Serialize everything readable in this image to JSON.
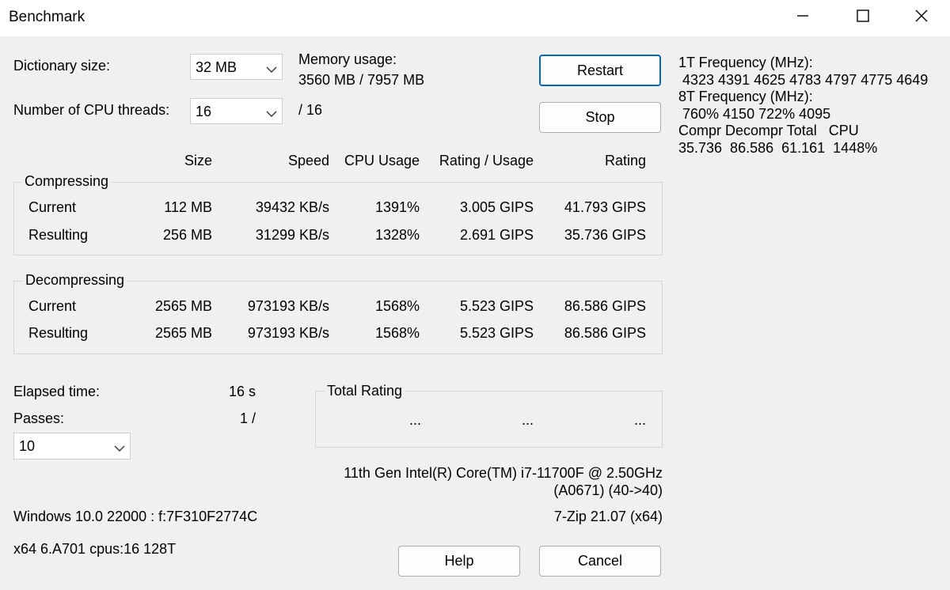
{
  "window": {
    "title": "Benchmark",
    "controls": {
      "minimize": "minimize",
      "maximize": "maximize",
      "close": "close"
    }
  },
  "settings": {
    "dictionary_label": "Dictionary size:",
    "dictionary_value": "32 MB",
    "threads_label": "Number of CPU threads:",
    "threads_value": "16",
    "threads_max": "/ 16",
    "memory_label": "Memory usage:",
    "memory_value": "3560 MB / 7957 MB"
  },
  "buttons": {
    "restart": "Restart",
    "stop": "Stop",
    "help": "Help",
    "cancel": "Cancel"
  },
  "table": {
    "headers": {
      "size": "Size",
      "speed": "Speed",
      "cpu": "CPU Usage",
      "rating_usage": "Rating / Usage",
      "rating": "Rating"
    },
    "compressing": {
      "label": "Compressing",
      "rows": [
        {
          "name": "Current",
          "size": "112 MB",
          "speed": "39432 KB/s",
          "cpu": "1391%",
          "rating_usage": "3.005 GIPS",
          "rating": "41.793 GIPS"
        },
        {
          "name": "Resulting",
          "size": "256 MB",
          "speed": "31299 KB/s",
          "cpu": "1328%",
          "rating_usage": "2.691 GIPS",
          "rating": "35.736 GIPS"
        }
      ]
    },
    "decompressing": {
      "label": "Decompressing",
      "rows": [
        {
          "name": "Current",
          "size": "2565 MB",
          "speed": "973193 KB/s",
          "cpu": "1568%",
          "rating_usage": "5.523 GIPS",
          "rating": "86.586 GIPS"
        },
        {
          "name": "Resulting",
          "size": "2565 MB",
          "speed": "973193 KB/s",
          "cpu": "1568%",
          "rating_usage": "5.523 GIPS",
          "rating": "86.586 GIPS"
        }
      ]
    }
  },
  "status": {
    "elapsed_label": "Elapsed time:",
    "elapsed_value": "16 s",
    "passes_label": "Passes:",
    "passes_value": "1 /",
    "passes_select": "10"
  },
  "total_rating": {
    "label": "Total Rating",
    "values": [
      "...",
      "...",
      "..."
    ]
  },
  "cpu_info": {
    "line1": "11th Gen Intel(R) Core(TM) i7-11700F @ 2.50GHz",
    "line2": "(A0671) (40->40)",
    "zip_version": "7-Zip 21.07 (x64)"
  },
  "system": {
    "windows": "Windows 10.0 22000 :  f:7F310F2774C",
    "arch": "x64 6.A701 cpus:16 128T"
  },
  "side_info": {
    "freq1_label": "1T Frequency (MHz):",
    "freq1_values": " 4323 4391 4625 4783 4797 4775 4649",
    "freq8_label": "8T Frequency (MHz):",
    "freq8_values": " 760% 4150 722% 4095",
    "summary_header": "Compr Decompr Total   CPU",
    "summary_values": "35.736  86.586  61.161  1448%"
  }
}
